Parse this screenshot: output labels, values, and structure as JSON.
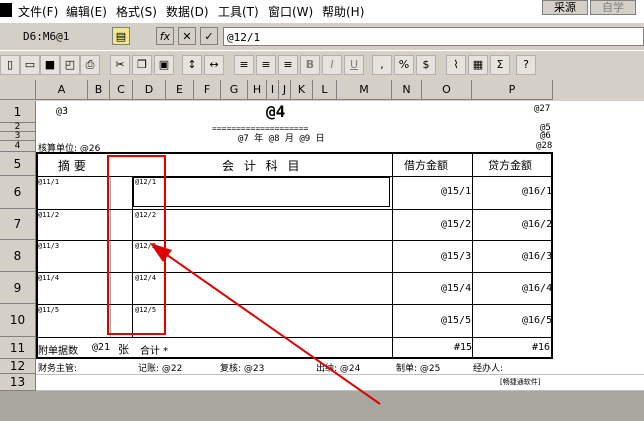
{
  "menubar": {
    "items": [
      "文件(F)",
      "编辑(E)",
      "格式(S)",
      "数据(D)",
      "工具(T)",
      "窗口(W)",
      "帮助(H)"
    ],
    "buttons": [
      "采源",
      "自学"
    ]
  },
  "formula_bar": {
    "cell_ref": "D6:M6@1",
    "fx": "fx",
    "cancel": "✕",
    "confirm": "✓",
    "formula": "@12/1"
  },
  "columns": [
    "A",
    "B",
    "C",
    "D",
    "E",
    "F",
    "G",
    "H",
    "I",
    "J",
    "K",
    "L",
    "M",
    "N",
    "O",
    "P"
  ],
  "rows": [
    "1",
    "2",
    "3",
    "4",
    "5",
    "6",
    "7",
    "8",
    "9",
    "10",
    "11",
    "12",
    "13"
  ],
  "sheet": {
    "r1_a": "@3",
    "title": "@4",
    "r1_p": "@27",
    "r2_p": "@5",
    "separator": "====================",
    "date_line": "@7 年 @8 月 @9 日",
    "r3_p": "@6",
    "unit_label": "核算单位: @26",
    "r4_p": "@28",
    "header_summary": "摘    要",
    "header_account": "会 计 科 目",
    "header_debit": "借方金额",
    "header_credit": "贷方金额",
    "detail_rows": [
      {
        "summary": "@11/1",
        "account": "@12/1",
        "debit": "@15/1",
        "credit": "@16/1"
      },
      {
        "summary": "@11/2",
        "account": "@12/2",
        "debit": "@15/2",
        "credit": "@16/2"
      },
      {
        "summary": "@11/3",
        "account": "@12/3",
        "debit": "@15/3",
        "credit": "@16/3"
      },
      {
        "summary": "@11/4",
        "account": "@12/4",
        "debit": "@15/4",
        "credit": "@16/4"
      },
      {
        "summary": "@11/5",
        "account": "@12/5",
        "debit": "@15/5",
        "credit": "@16/5"
      }
    ],
    "attach_label": "附单据数",
    "attach_value": "@21",
    "attach_unit": "张",
    "total_label": "合计 *",
    "total_debit": "#15",
    "total_credit": "#16",
    "footer": {
      "finance": "财务主管:",
      "bookkeeper": "记账: @22",
      "review": "复核: @23",
      "cashier": "出纳: @24",
      "maker": "制单: @25",
      "handler": "经办人:"
    },
    "credit_note": "[畅捷通软件]"
  }
}
